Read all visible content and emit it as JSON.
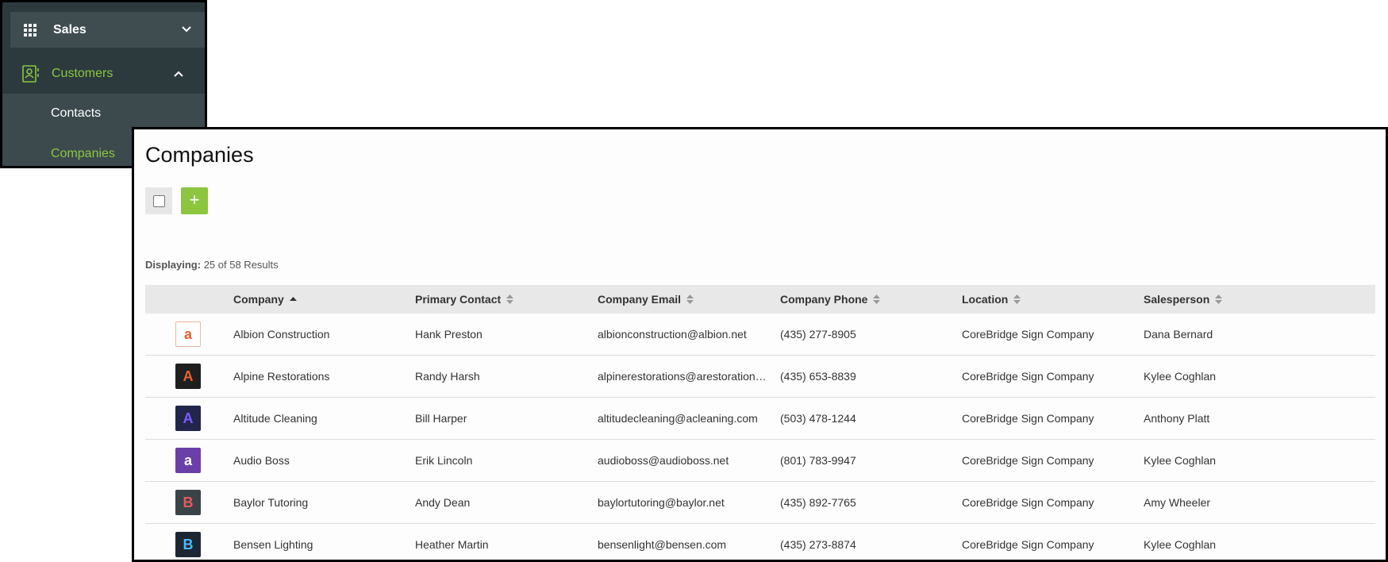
{
  "sidebar": {
    "sales_label": "Sales",
    "customers_label": "Customers",
    "contacts_label": "Contacts",
    "companies_label": "Companies",
    "accent_color": "#8cc63f"
  },
  "main": {
    "title": "Companies",
    "add_label": "+",
    "displaying_label": "Displaying:",
    "displaying_value": "25 of 58 Results",
    "columns": [
      {
        "label": "Company",
        "sort": "ascending"
      },
      {
        "label": "Primary Contact",
        "sort": "none"
      },
      {
        "label": "Company Email",
        "sort": "none"
      },
      {
        "label": "Company Phone",
        "sort": "none"
      },
      {
        "label": "Location",
        "sort": "none"
      },
      {
        "label": "Salesperson",
        "sort": "none"
      }
    ],
    "rows": [
      {
        "logo_icon": "albion-logo-icon",
        "logo_letter": "a",
        "logo_bg": "#ffffff",
        "logo_fg": "#e8622c",
        "company": "Albion Construction",
        "contact": "Hank Preston",
        "email": "albionconstruction@albion.net",
        "phone": "(435) 277-8905",
        "location": "CoreBridge Sign Company",
        "salesperson": "Dana Bernard"
      },
      {
        "logo_icon": "alpine-logo-icon",
        "logo_letter": "A",
        "logo_bg": "#1f1f1f",
        "logo_fg": "#e8622c",
        "company": "Alpine Restorations",
        "contact": "Randy Harsh",
        "email": "alpinerestorations@arestorations.com",
        "phone": "(435) 653-8839",
        "location": "CoreBridge Sign Company",
        "salesperson": "Kylee Coghlan"
      },
      {
        "logo_icon": "altitude-logo-icon",
        "logo_letter": "A",
        "logo_bg": "#23264a",
        "logo_fg": "#7b5cff",
        "company": "Altitude Cleaning",
        "contact": "Bill Harper",
        "email": "altitudecleaning@acleaning.com",
        "phone": "(503) 478-1244",
        "location": "CoreBridge Sign Company",
        "salesperson": "Anthony Platt"
      },
      {
        "logo_icon": "audioboss-logo-icon",
        "logo_letter": "a",
        "logo_bg": "#6b3fa8",
        "logo_fg": "#ffffff",
        "company": "Audio Boss",
        "contact": "Erik Lincoln",
        "email": "audioboss@audioboss.net",
        "phone": "(801) 783-9947",
        "location": "CoreBridge Sign Company",
        "salesperson": "Kylee Coghlan"
      },
      {
        "logo_icon": "baylor-logo-icon",
        "logo_letter": "B",
        "logo_bg": "#3a4448",
        "logo_fg": "#e85a5a",
        "company": "Baylor Tutoring",
        "contact": "Andy Dean",
        "email": "baylortutoring@baylor.net",
        "phone": "(435) 892-7765",
        "location": "CoreBridge Sign Company",
        "salesperson": "Amy Wheeler"
      },
      {
        "logo_icon": "bensen-logo-icon",
        "logo_letter": "B",
        "logo_bg": "#1c2733",
        "logo_fg": "#4fb8ff",
        "company": "Bensen Lighting",
        "contact": "Heather Martin",
        "email": "bensenlight@bensen.com",
        "phone": "(435) 273-8874",
        "location": "CoreBridge Sign Company",
        "salesperson": "Kylee Coghlan"
      }
    ]
  }
}
